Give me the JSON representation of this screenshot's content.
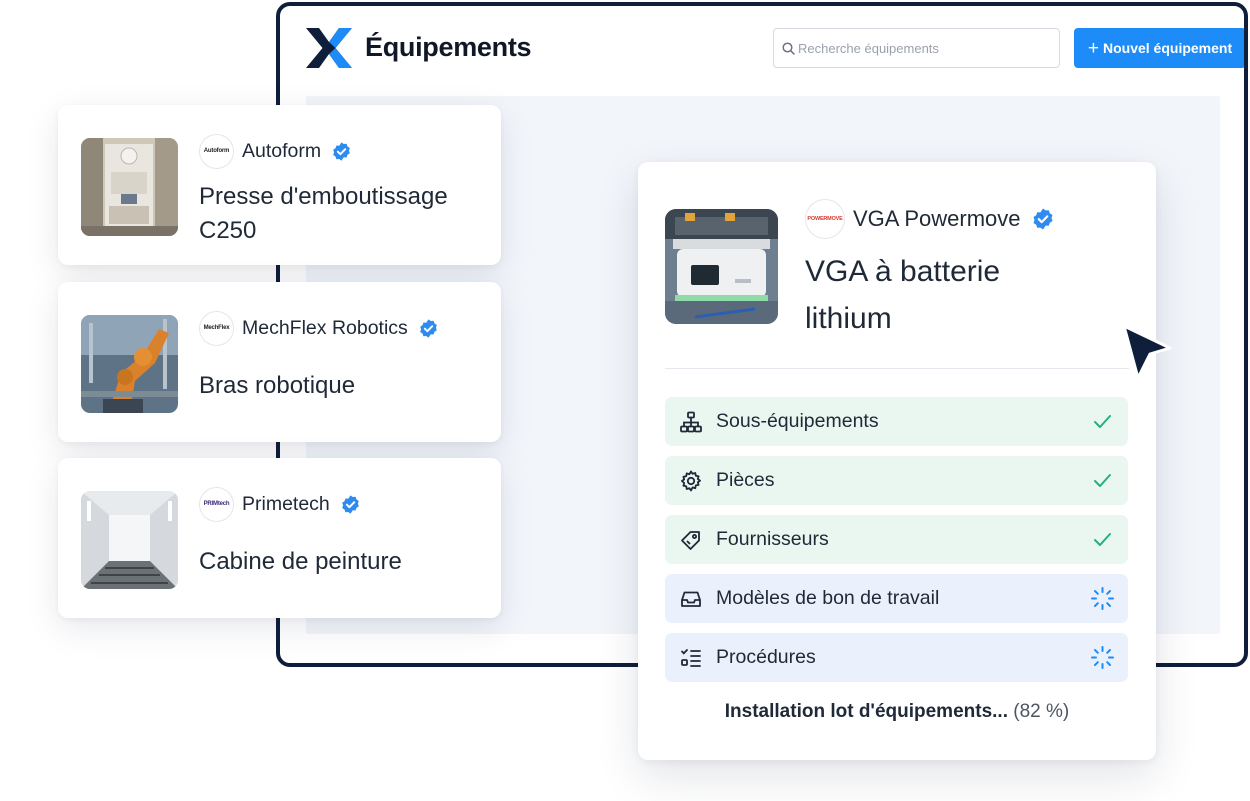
{
  "app": {
    "title": "Équipements",
    "search_placeholder": "Recherche équipements",
    "new_button_label": "Nouvel équipement",
    "accent_color": "#1d8cf8",
    "frame_color": "#0f1e3a"
  },
  "equipment_cards": [
    {
      "brand": "Autoform",
      "brand_logo_text": "Autoform",
      "verified": true,
      "title": "Presse d'emboutissage C250",
      "thumb": "press-photo"
    },
    {
      "brand": "MechFlex Robotics",
      "brand_logo_text": "MechFlex",
      "verified": true,
      "title": "Bras robotique",
      "thumb": "robot-arm-photo"
    },
    {
      "brand": "Primetech",
      "brand_logo_text": "PRIMtech",
      "verified": true,
      "title": "Cabine de peinture",
      "thumb": "paint-booth-photo"
    }
  ],
  "install_panel": {
    "brand": "VGA Powermove",
    "brand_logo_text": "POWERMOVE",
    "verified": true,
    "title": "VGA à batterie lithium",
    "steps": [
      {
        "label": "Sous-équipements",
        "icon": "hierarchy-icon",
        "status": "done"
      },
      {
        "label": "Pièces",
        "icon": "gear-icon",
        "status": "done"
      },
      {
        "label": "Fournisseurs",
        "icon": "tag-icon",
        "status": "done"
      },
      {
        "label": "Modèles de bon de travail",
        "icon": "inbox-tray-icon",
        "status": "loading"
      },
      {
        "label": "Procédures",
        "icon": "checklist-icon",
        "status": "loading"
      }
    ],
    "progress_label": "Installation lot d'équipements...",
    "progress_percent_text": "(82 %)",
    "progress_value": 82,
    "done_color": "#22b07d",
    "loading_color": "#1d8cf8"
  }
}
